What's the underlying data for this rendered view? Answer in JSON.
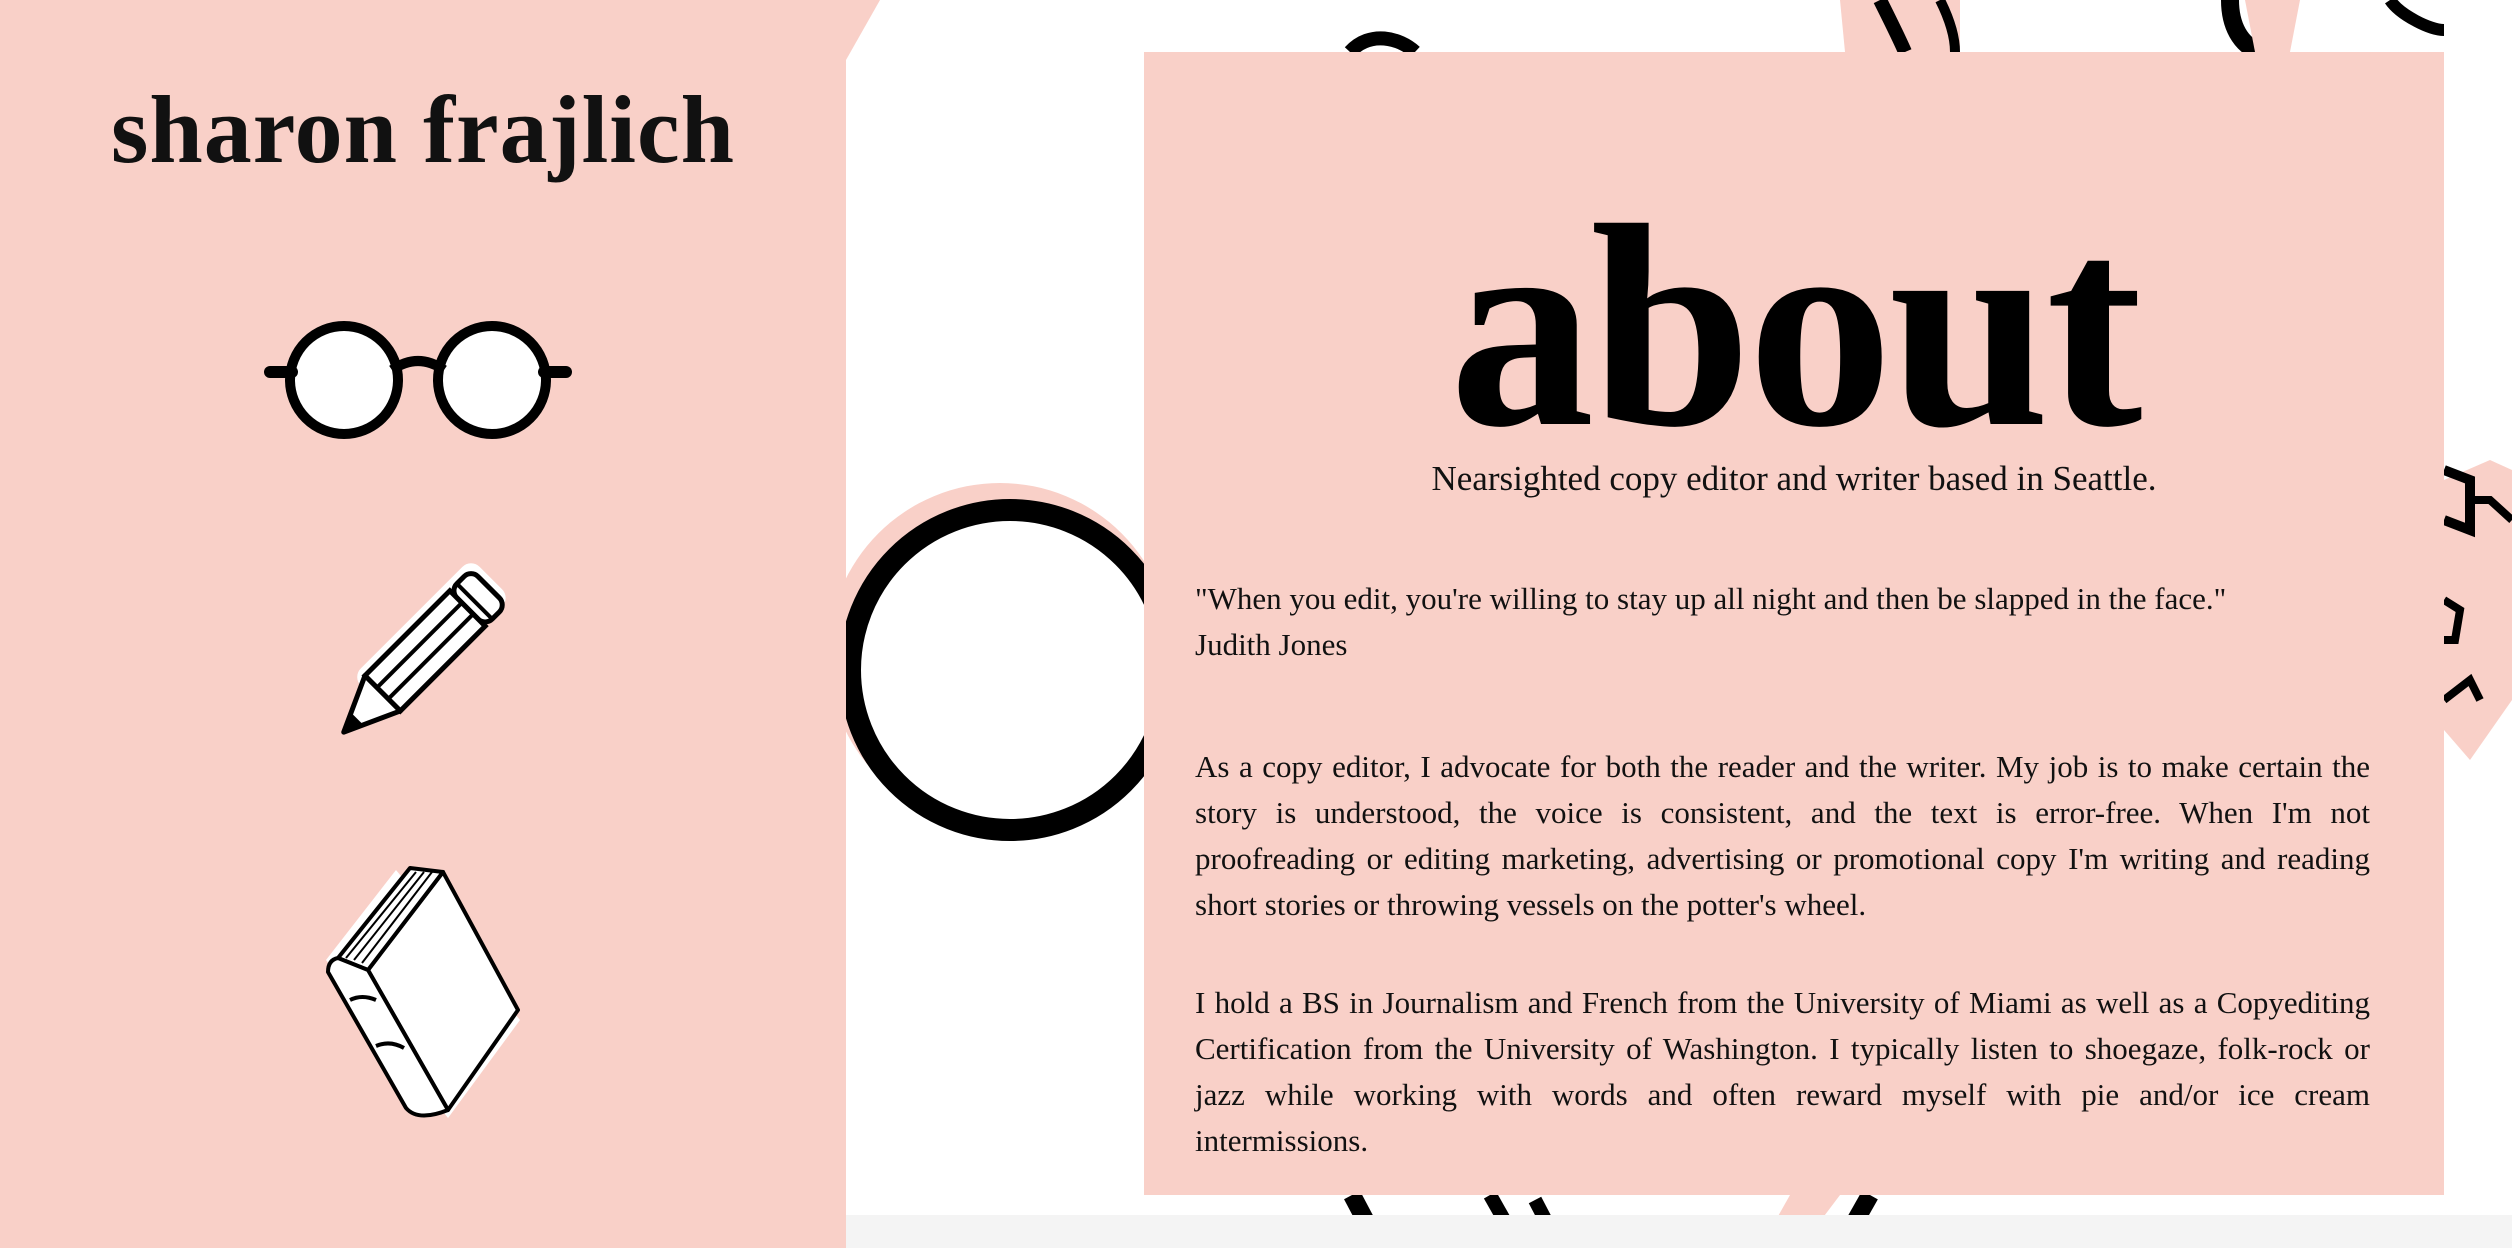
{
  "site": {
    "title": "sharon frajlich"
  },
  "nav": [
    {
      "icon": "glasses-icon",
      "label": "about"
    },
    {
      "icon": "pencil-icon",
      "label": "writing"
    },
    {
      "icon": "book-icon",
      "label": "editing"
    }
  ],
  "about": {
    "heading": "about",
    "tagline": "Nearsighted copy editor and writer based in Seattle.",
    "quote": "\"When you edit, you're willing to stay up all night and then be slapped in the face.\"",
    "quote_author": "Judith Jones",
    "paragraphs": [
      "As a copy editor, I advocate for both the reader and the writer. My job is to make certain the story is understood, the voice is consistent, and the text is error-free. When I'm not proofreading or editing marketing, advertising or promotional copy I'm writing and reading short stories or throwing vessels on the potter's wheel.",
      "I hold a BS in Journalism and French from the University of Miami as well as a Copyediting Certification from the University of Washington. I typically listen to shoegaze, folk-rock or jazz while working with words and often reward myself with pie and/or ice cream intermissions."
    ]
  },
  "colors": {
    "panel_pink": "#f9d0c8",
    "background": "#ffffff",
    "ink": "#111111"
  }
}
